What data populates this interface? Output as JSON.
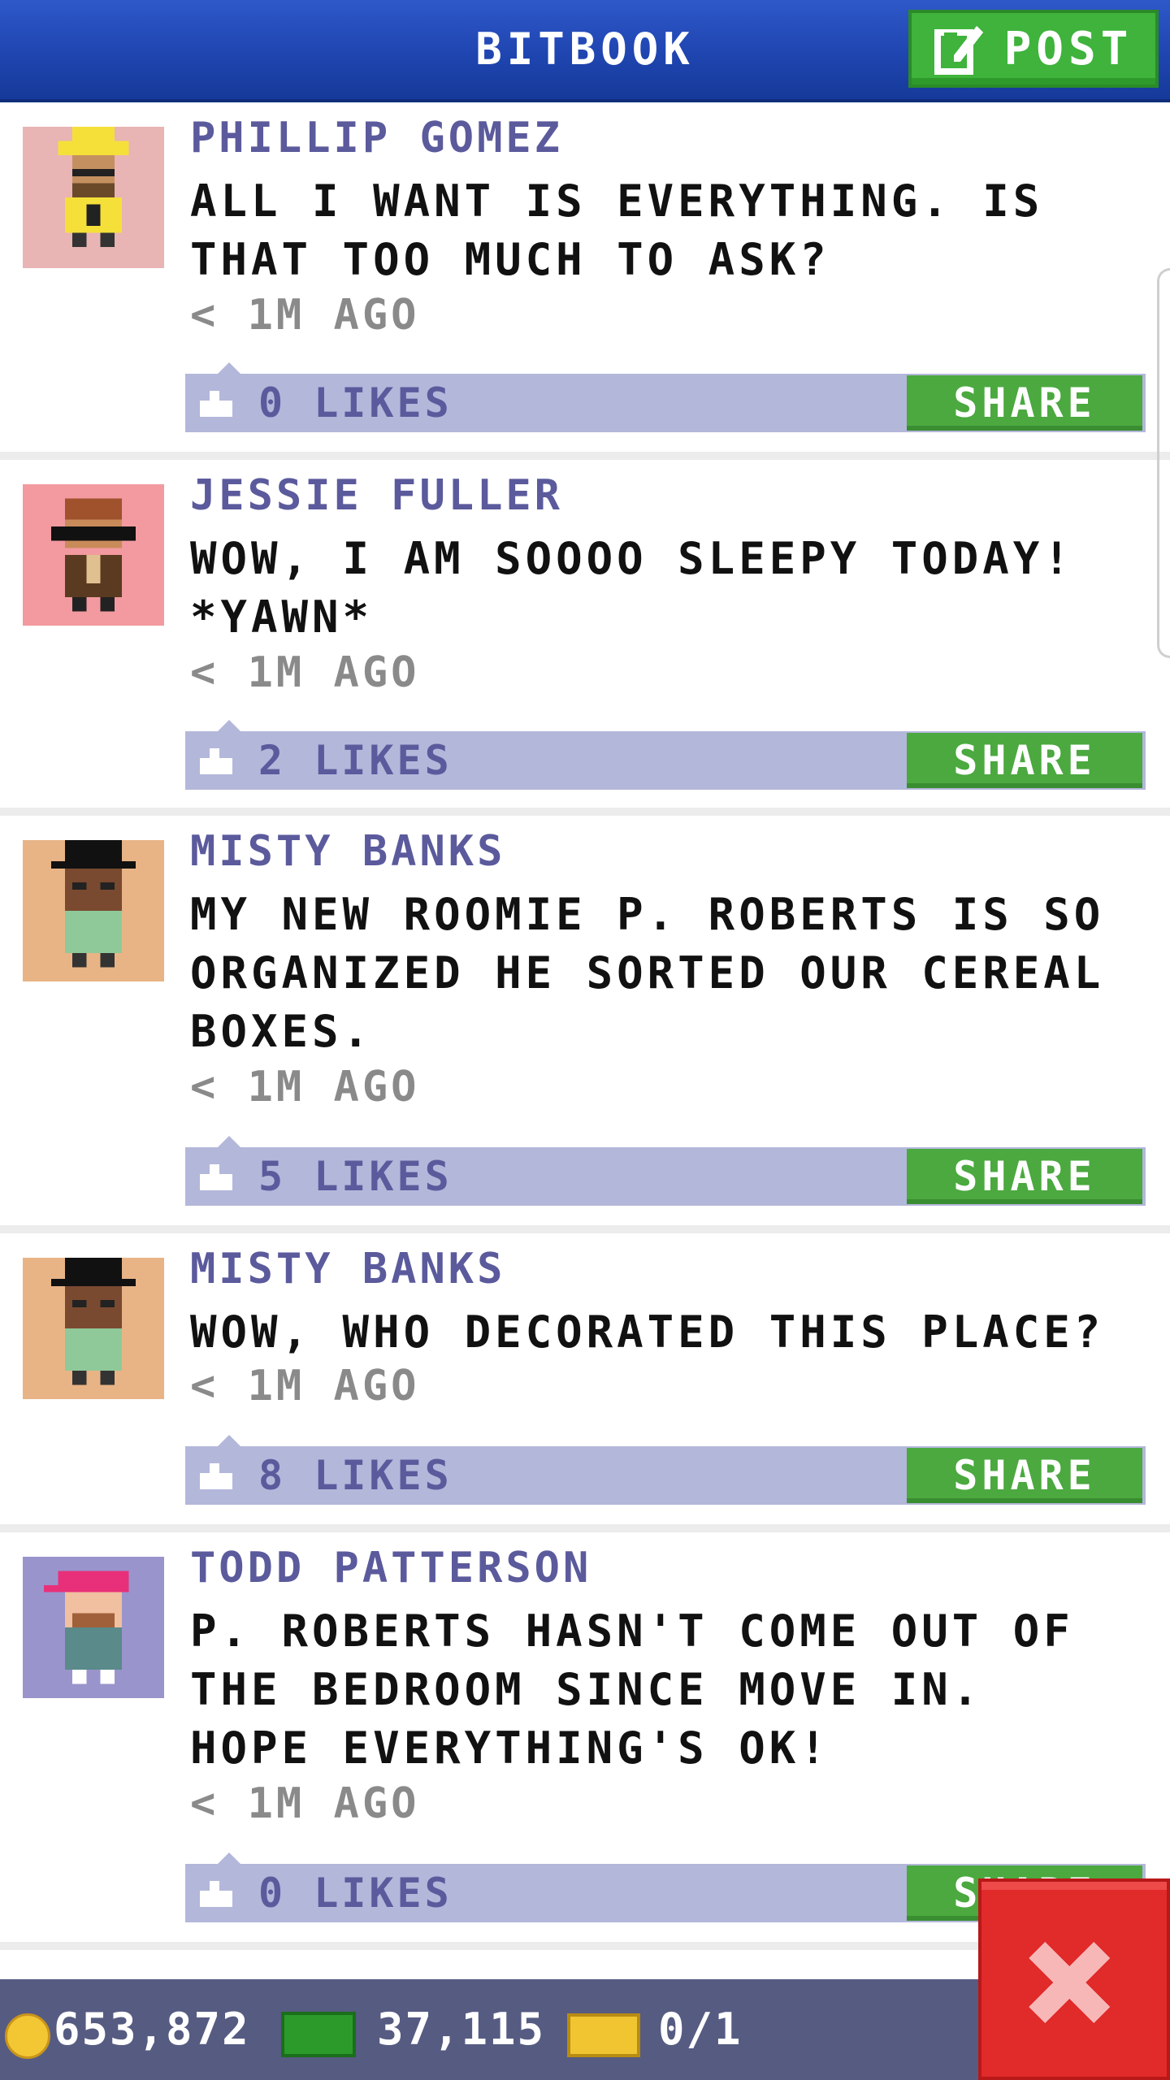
{
  "header": {
    "title": "BITBOOK",
    "post_label": "POST"
  },
  "posts": [
    {
      "author": "PHILLIP GOMEZ",
      "message": "ALL I WANT IS EVERYTHING. IS THAT TOO MUCH TO ASK?",
      "time": "< 1M AGO",
      "likes": "0 LIKES",
      "share": "SHARE",
      "avatar_bg": "#e8b4b4"
    },
    {
      "author": "JESSIE FULLER",
      "message": "WOW, I AM SOOOO SLEEPY TODAY! *YAWN*",
      "time": "< 1M AGO",
      "likes": "2 LIKES",
      "share": "SHARE",
      "avatar_bg": "#f29aa0"
    },
    {
      "author": "MISTY BANKS",
      "message": "MY NEW ROOMIE P. ROBERTS IS SO ORGANIZED HE SORTED OUR CEREAL BOXES.",
      "time": "< 1M AGO",
      "likes": "5 LIKES",
      "share": "SHARE",
      "avatar_bg": "#e8b486"
    },
    {
      "author": "MISTY BANKS",
      "message": "WOW, WHO DECORATED THIS PLACE?",
      "time": "< 1M AGO",
      "likes": "8 LIKES",
      "share": "SHARE",
      "avatar_bg": "#e8b486"
    },
    {
      "author": "TODD PATTERSON",
      "message": "P. ROBERTS HASN'T COME OUT OF THE BEDROOM SINCE MOVE IN. HOPE EVERYTHING'S OK!",
      "time": "< 1M AGO",
      "likes": "0 LIKES",
      "share": "SHARE",
      "avatar_bg": "#9a94cc"
    }
  ],
  "footer": {
    "coins": "653,872",
    "bux": "37,115",
    "tickets": "0/1"
  },
  "colors": {
    "header": "#1f45b0",
    "accent_green": "#4ba93f",
    "likes_bar": "#b3b7da",
    "author_text": "#5b5a9c",
    "close_red": "#e12a2a"
  },
  "icons": [
    "edit-icon",
    "thumbs-up-icon",
    "coin-icon",
    "cash-icon",
    "ticket-icon",
    "close-icon"
  ]
}
